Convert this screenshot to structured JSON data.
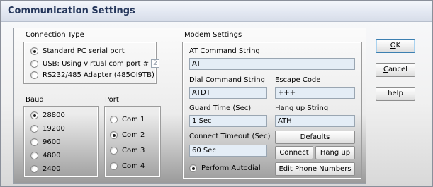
{
  "window": {
    "title": "Communication Settings"
  },
  "connection": {
    "label": "Connection Type",
    "options": [
      {
        "label": "Standard PC serial port",
        "checked": true
      },
      {
        "label": "USB: Using virtual com port #",
        "checked": false
      },
      {
        "label": "RS232/485 Adapter (485OI9TB)",
        "checked": false
      }
    ],
    "com_port": "2"
  },
  "baud": {
    "label": "Baud",
    "options": [
      {
        "label": "28800",
        "checked": true
      },
      {
        "label": "19200",
        "checked": false
      },
      {
        "label": "9600",
        "checked": false
      },
      {
        "label": "4800",
        "checked": false
      },
      {
        "label": "2400",
        "checked": false
      }
    ]
  },
  "port": {
    "label": "Port",
    "options": [
      {
        "label": "Com 1",
        "checked": false
      },
      {
        "label": "Com 2",
        "checked": true
      },
      {
        "label": "Com 3",
        "checked": false
      },
      {
        "label": "Com 4",
        "checked": false
      }
    ]
  },
  "modem": {
    "label": "Modem Settings",
    "at_command": {
      "label": "AT Command String",
      "value": "AT"
    },
    "dial_command": {
      "label": "Dial Command String",
      "value": "ATDT"
    },
    "escape_code": {
      "label": "Escape Code",
      "value": "+++"
    },
    "guard_time": {
      "label": "Guard Time (Sec)",
      "value": "1 Sec"
    },
    "hang_up_string": {
      "label": "Hang up String",
      "value": "ATH"
    },
    "connect_timeout": {
      "label": "Connect Timeout (Sec)",
      "value": "60 Sec"
    },
    "perform_autodial": {
      "label": "Perform Autodial",
      "checked": true
    },
    "buttons": {
      "defaults": "Defaults",
      "connect": "Connect",
      "hang_up": "Hang up",
      "edit_phone_numbers": "Edit Phone Numbers"
    }
  },
  "dialog_buttons": {
    "ok_first": "O",
    "ok_rest": "K",
    "cancel_first": "C",
    "cancel_rest": "ancel",
    "help": "help"
  }
}
